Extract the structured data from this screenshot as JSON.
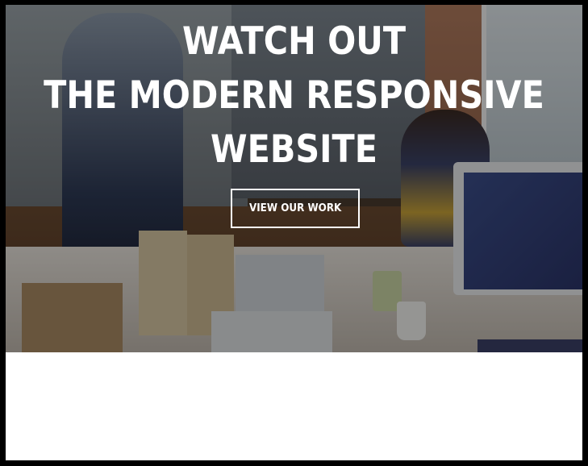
{
  "hero": {
    "headline_line1": "WATCH OUT",
    "headline_line2": "THE MODERN RESPONSIVE",
    "headline_line3": "WEBSITE",
    "cta_label": "VIEW OUR WORK"
  },
  "colors": {
    "text": "#ffffff",
    "frame": "#000000",
    "overlay": "rgba(0,0,0,0.38)",
    "below_background": "#ffffff"
  }
}
